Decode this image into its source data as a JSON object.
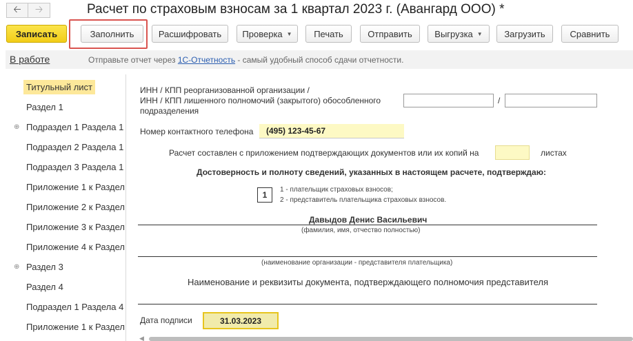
{
  "window": {
    "title": "Расчет по страховым взносам за 1 квартал 2023 г. (Авангард ООО) *",
    "back_icon": "arrow-left",
    "forward_icon": "arrow-right"
  },
  "toolbar": {
    "save_label": "Записать",
    "fill_label": "Заполнить",
    "decode_label": "Расшифровать",
    "check_label": "Проверка",
    "print_label": "Печать",
    "send_label": "Отправить",
    "export_label": "Выгрузка",
    "load_label": "Загрузить",
    "compare_label": "Сравнить",
    "highlight_color": "#d9534f",
    "primary_color": "#f5d31f"
  },
  "status": {
    "state_link": "В работе",
    "message_before": "Отправьте отчет через ",
    "message_link": "1С-Отчетность",
    "message_after": " - самый удобный способ сдачи отчетности."
  },
  "sections": [
    {
      "label": "Титульный лист",
      "selected": true,
      "expandable": false
    },
    {
      "label": "Раздел 1",
      "selected": false,
      "expandable": false
    },
    {
      "label": "Подраздел 1 Раздела 1",
      "selected": false,
      "expandable": true
    },
    {
      "label": "Подраздел 2 Раздела 1",
      "selected": false,
      "expandable": false
    },
    {
      "label": "Подраздел 3 Раздела 1",
      "selected": false,
      "expandable": false
    },
    {
      "label": "Приложение 1 к Раздел",
      "selected": false,
      "expandable": false
    },
    {
      "label": "Приложение 2 к Раздел",
      "selected": false,
      "expandable": false
    },
    {
      "label": "Приложение 3 к Раздел",
      "selected": false,
      "expandable": false
    },
    {
      "label": "Приложение 4 к Раздел",
      "selected": false,
      "expandable": false
    },
    {
      "label": "Раздел 3",
      "selected": false,
      "expandable": true
    },
    {
      "label": "Раздел 4",
      "selected": false,
      "expandable": false
    },
    {
      "label": "Подраздел 1 Раздела 4",
      "selected": false,
      "expandable": false
    },
    {
      "label": "Приложение 1 к Раздел",
      "selected": false,
      "expandable": false
    }
  ],
  "form": {
    "reorg_label_1": "ИНН / КПП реорганизованной организации /",
    "reorg_label_2": "ИНН / КПП лишенного полномочий (закрытого) обособленного",
    "reorg_label_3": "подразделения",
    "inn_kpp_separator": "/",
    "phone_label": "Номер контактного телефона",
    "phone_value": "(495) 123-45-67",
    "attachment_text": "Расчет составлен с приложением подтверждающих документов или их копий на",
    "attachment_value": "",
    "sheets_label": "листах",
    "confirm_text": "Достоверность и полноту сведений, указанных в настоящем расчете, подтверждаю:",
    "signer_code": "1",
    "signer_option_1": "1 - плательщик страховых взносов;",
    "signer_option_2": "2 - представитель плательщика страховых взносов.",
    "signer_name": "Давыдов Денис Васильевич",
    "signer_name_caption": "(фамилия, имя, отчество полностью)",
    "org_caption": "(наименование организации - представителя плательщика)",
    "doc_caption": "Наименование и реквизиты документа, подтверждающего полномочия представителя",
    "sign_date_label": "Дата подписи",
    "sign_date_value": "31.03.2023"
  }
}
